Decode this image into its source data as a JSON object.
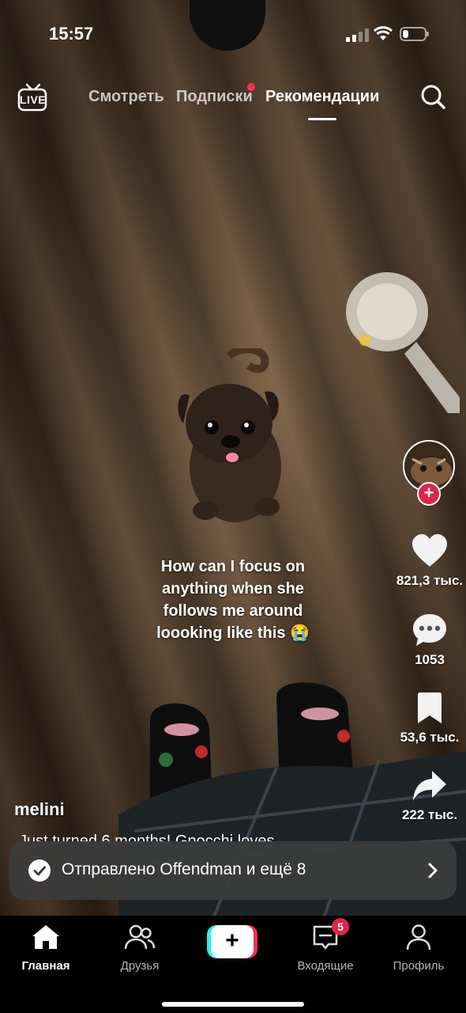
{
  "status_bar": {
    "time": "15:57",
    "battery_level_percent": 25
  },
  "top_nav": {
    "live_label": "LIVE",
    "tabs": [
      {
        "label": "Смотреть",
        "active": false
      },
      {
        "label": "Подписки",
        "active": false,
        "has_notification_dot": true
      },
      {
        "label": "Рекомендации",
        "active": true
      }
    ]
  },
  "video": {
    "caption_lines": [
      "How can I focus on",
      "anything when she",
      "follows me around",
      "loooking like this 😭"
    ],
    "author": "melini",
    "description": "Just turned 6 months! Gnocchi loves"
  },
  "actions": {
    "likes": "821,3 тыс.",
    "comments": "1053",
    "bookmarks": "53,6 тыс.",
    "shares": "222 тыс."
  },
  "toast": {
    "message": "Отправлено Offendman и ещё 8"
  },
  "bottom_nav": {
    "items": [
      {
        "label": "Главная",
        "icon": "home-icon",
        "active": true
      },
      {
        "label": "Друзья",
        "icon": "friends-icon",
        "active": false
      },
      {
        "label": "Входящие",
        "icon": "inbox-icon",
        "active": false,
        "badge": "5"
      },
      {
        "label": "Профиль",
        "icon": "profile-icon",
        "active": false
      }
    ]
  },
  "colors": {
    "accent_red": "#fe2c55",
    "accent_cyan": "#25f4ee",
    "follow_red": "#e0244a"
  }
}
